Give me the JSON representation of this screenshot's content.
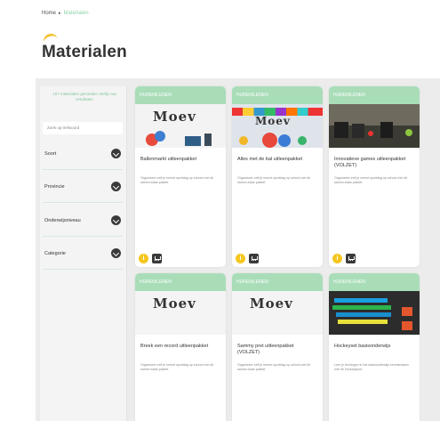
{
  "breadcrumb": {
    "home": "Home",
    "current": "Materialen"
  },
  "page": {
    "title": "Materialen"
  },
  "sidebar": {
    "result_count": "167 materialen gevonden Verfijn uw resultaten",
    "search_placeholder": "Zoek op trefwoord",
    "filters": [
      {
        "label": "Soort"
      },
      {
        "label": "Provincie"
      },
      {
        "label": "Onderwijsniveau"
      },
      {
        "label": "Categorie"
      }
    ]
  },
  "cards": [
    {
      "tag": "HUREN/LENEN",
      "title": "Ballenmarkt uitleenpakket",
      "desc": "Organiseer zelf je meest sportdag op school met dit samen-klaar pakket"
    },
    {
      "tag": "HUREN/LENEN",
      "title": "Alles met de bal uitleenpakket",
      "desc": "Organiseer zelf je meest sportdag op school met dit samen-klaar pakket"
    },
    {
      "tag": "HUREN/LENEN",
      "title": "Innovatieve games uitleenpakket (VOLZET)",
      "desc": "Organiseer zelf je meest sportdag op school met dit samen-klaar pakket"
    },
    {
      "tag": "HUREN/LENEN",
      "title": "Breek een record uitleenpakket",
      "desc": "Organiseer zelf je meest sportdag op school met dit samen-klaar pakket"
    },
    {
      "tag": "HUREN/LENEN",
      "title": "Sammy pret uitleenpakket (VOLZET)",
      "desc": "Organiseer zelf je meest sportdag op school met dit samen-klaar pakket"
    },
    {
      "tag": "HUREN/LENEN",
      "title": "Hockeyset basisonderwijs",
      "desc": "Leer je leerlingen in het basisonderwijs kennismaken met de hockeysport"
    }
  ],
  "logo": {
    "text": "Moev"
  },
  "icons": {
    "info": "i",
    "cart": "cart-icon",
    "chevron": "chevron-down-icon"
  },
  "colors": {
    "accent_green": "#a9ddb8",
    "accent_yellow": "#f4c61f",
    "dark": "#3a3a3a"
  }
}
